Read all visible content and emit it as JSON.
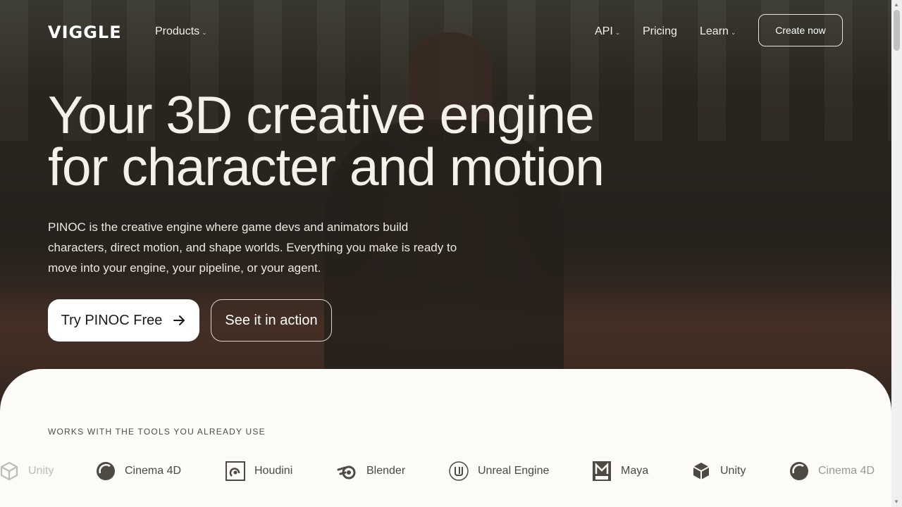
{
  "brand": {
    "logo_text": "VIGGLE"
  },
  "nav": {
    "products": "Products",
    "api": "API",
    "pricing": "Pricing",
    "learn": "Learn",
    "create_now": "Create now"
  },
  "hero": {
    "title_line1": "Your 3D creative engine",
    "title_line2": "for character and motion",
    "description": "PINOC is the creative engine where game devs and animators build characters, direct motion, and shape worlds. Everything you make is ready to move into your engine, your pipeline, or your agent.",
    "primary_cta": "Try PINOC Free",
    "secondary_cta": "See it in action"
  },
  "integrations": {
    "heading": "WORKS WITH THE TOOLS YOU ALREADY USE",
    "tools": [
      {
        "name": "Unity",
        "icon": "unity-icon"
      },
      {
        "name": "Cinema 4D",
        "icon": "cinema4d-icon"
      },
      {
        "name": "Houdini",
        "icon": "houdini-icon"
      },
      {
        "name": "Blender",
        "icon": "blender-icon"
      },
      {
        "name": "Unreal Engine",
        "icon": "unreal-engine-icon"
      },
      {
        "name": "Maya",
        "icon": "maya-icon"
      },
      {
        "name": "Unity",
        "icon": "unity-icon"
      },
      {
        "name": "Cinema 4D",
        "icon": "cinema4d-icon"
      }
    ]
  },
  "colors": {
    "hero_text": "#f5f1ea",
    "panel_bg": "#fcfbf8",
    "tool_text": "#4d4943"
  }
}
